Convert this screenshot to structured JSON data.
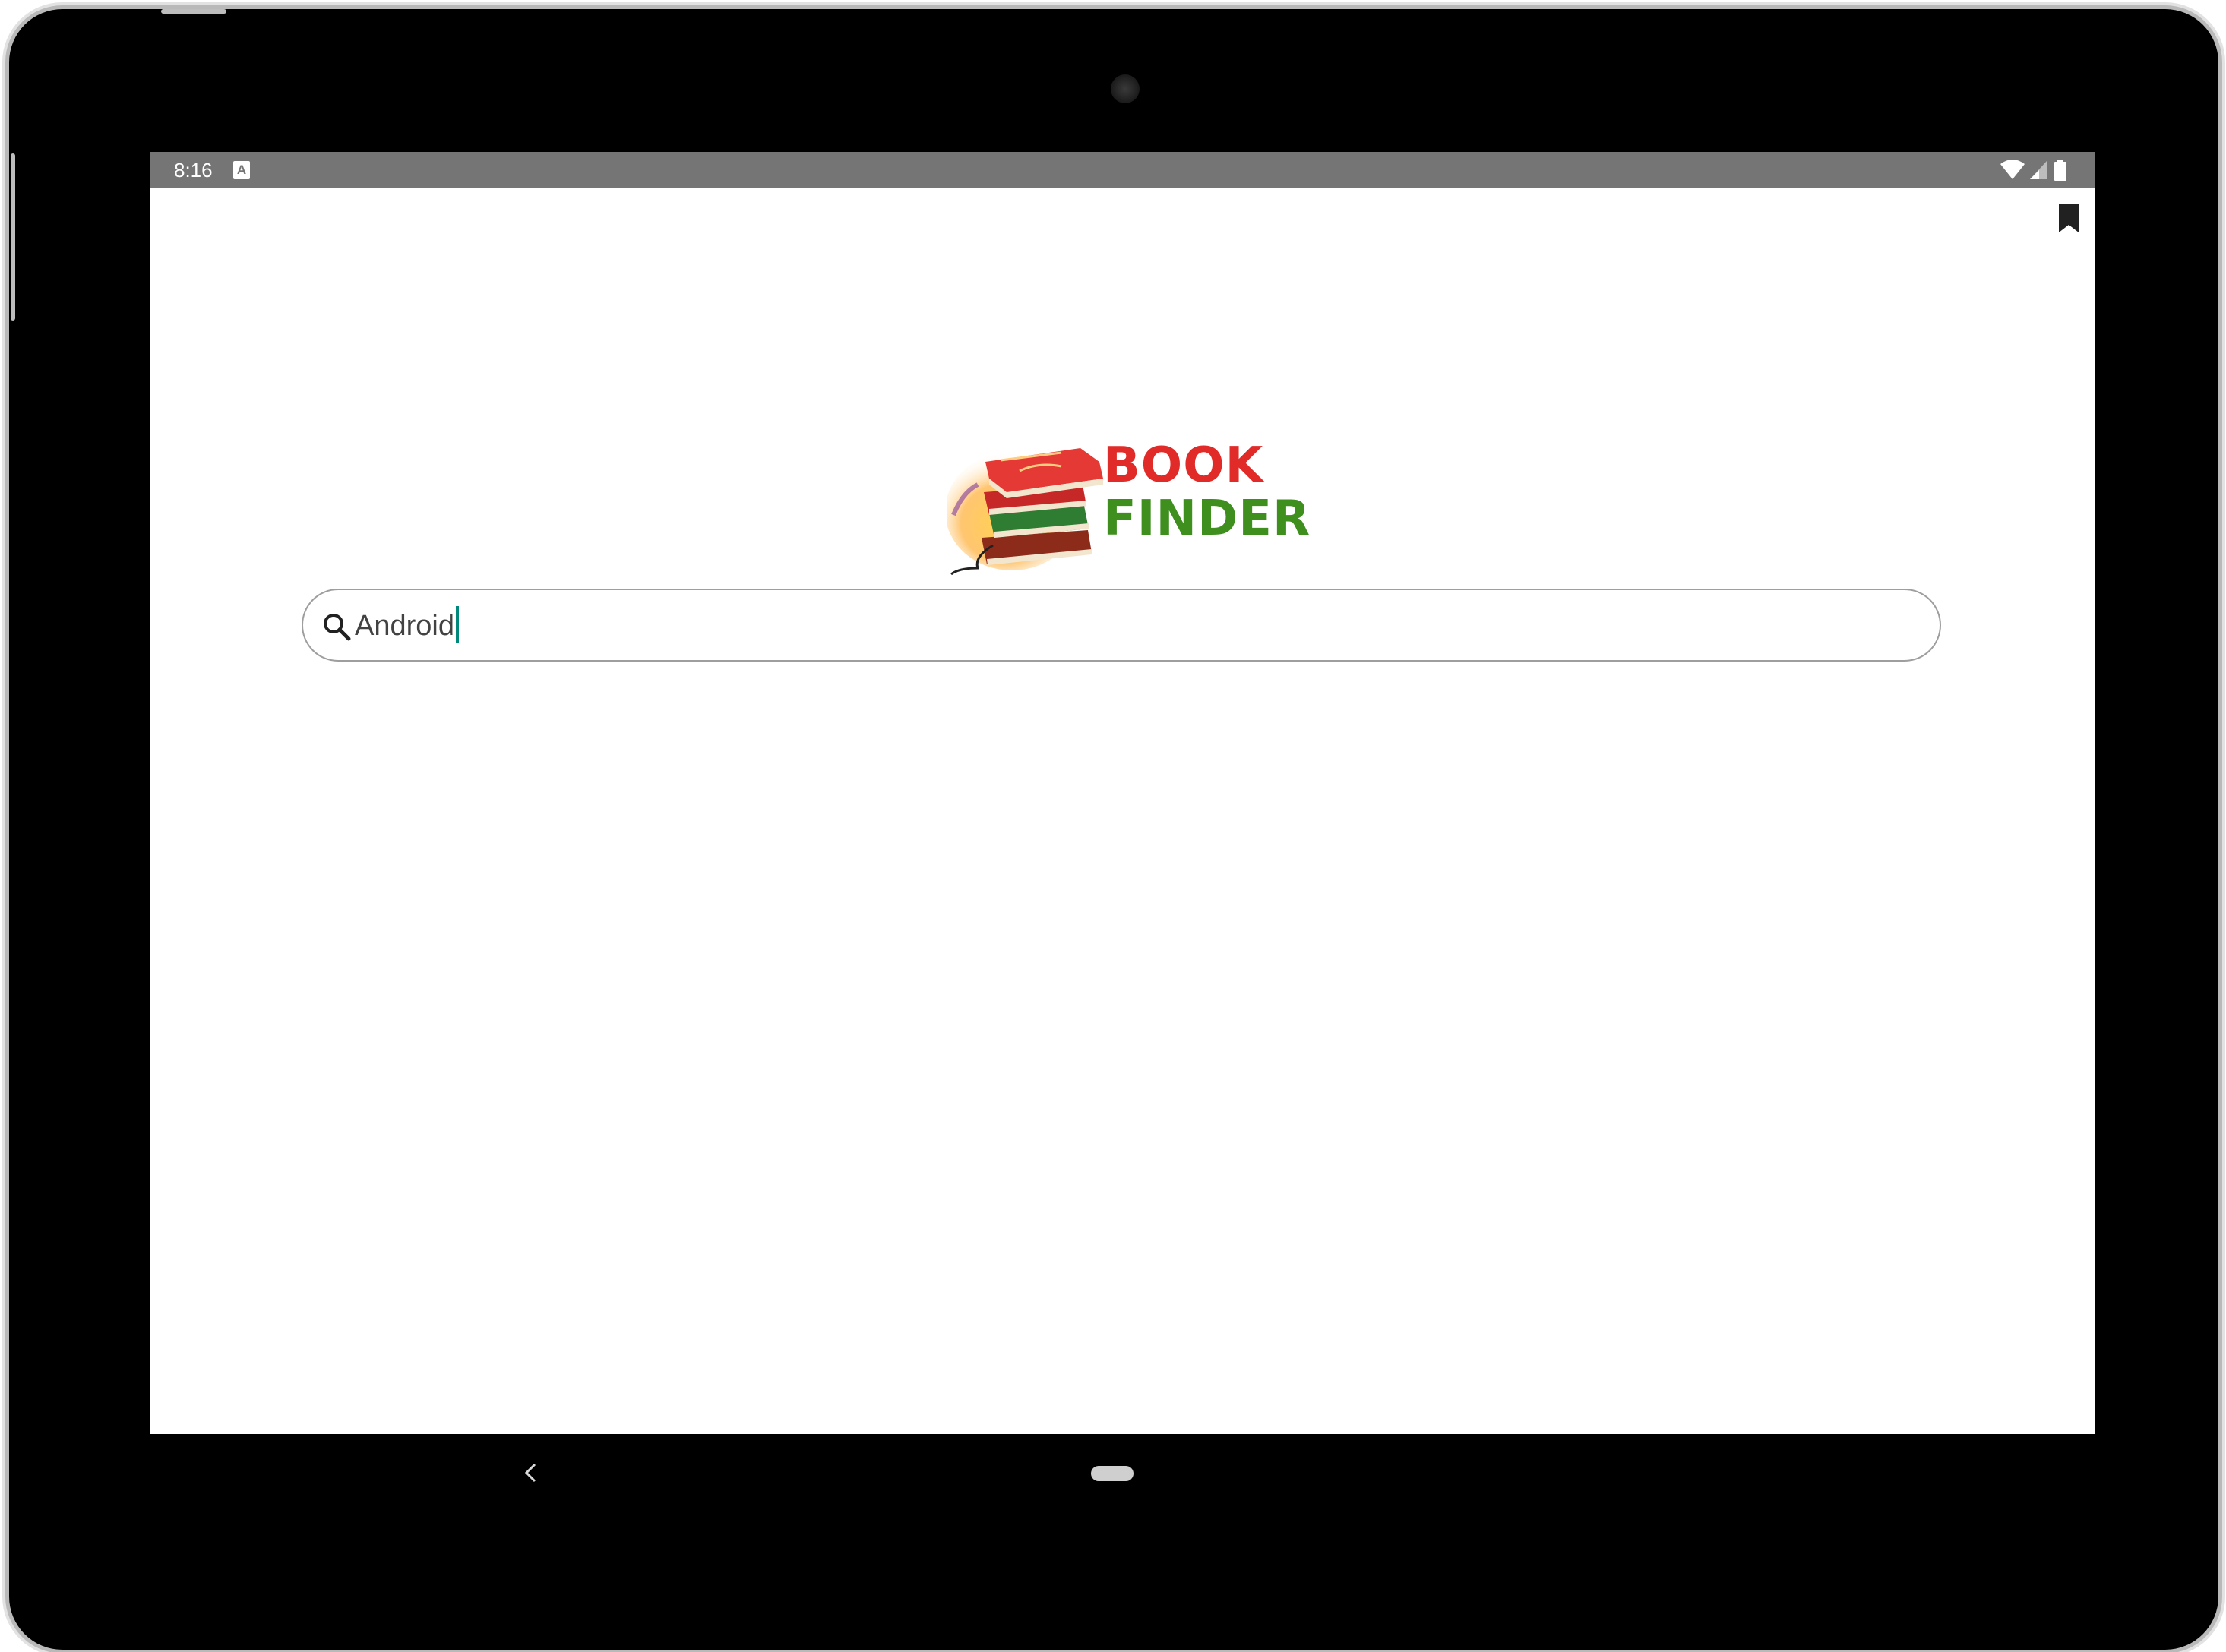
{
  "status_bar": {
    "time": "8:16",
    "keyboard_badge": "A",
    "icons": [
      "wifi-icon",
      "cell-signal-icon",
      "battery-icon"
    ]
  },
  "app_bar": {
    "bookmark_icon": "bookmark-icon"
  },
  "logo": {
    "line1": "BOOK",
    "line2": "FINDER",
    "colors": {
      "book": "#e02b28",
      "finder": "#3f8f1f"
    }
  },
  "search": {
    "value": "Android",
    "icon": "search-icon",
    "caret_color": "#00897b"
  },
  "nav": {
    "back_icon": "back-chevron-icon",
    "home_icon": "home-pill-icon"
  }
}
